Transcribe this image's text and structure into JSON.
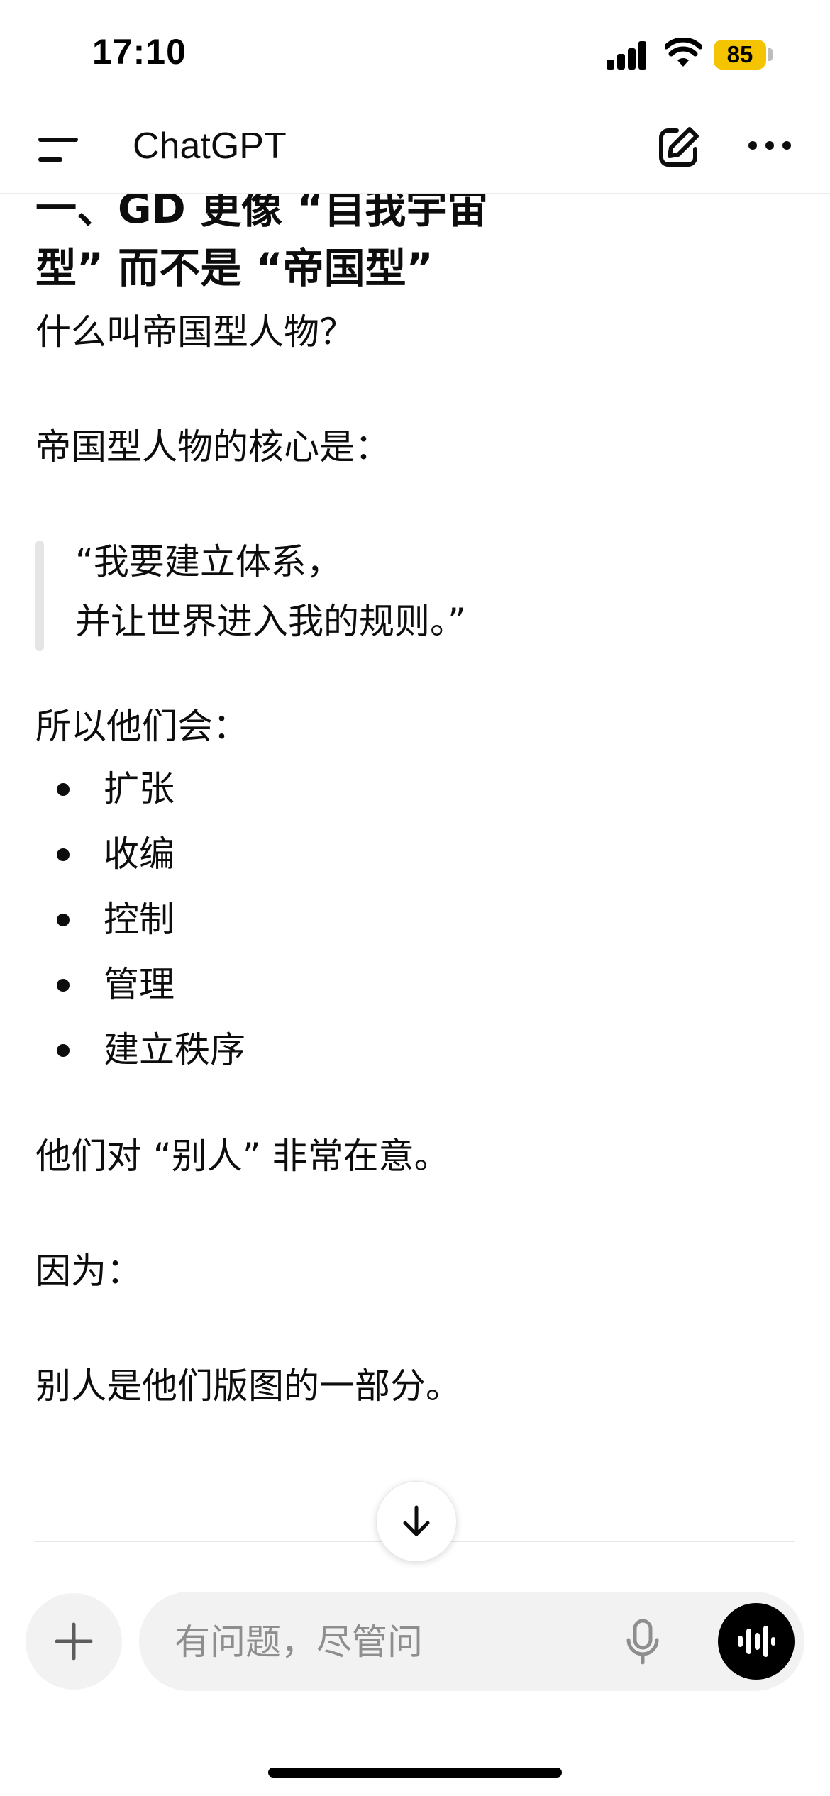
{
  "status_bar": {
    "time": "17:10",
    "battery_level": "85",
    "battery_color": "#f5c400"
  },
  "nav": {
    "title": "ChatGPT",
    "menu_icon": "menu-icon",
    "new_chat_icon": "edit-icon",
    "more_icon": "more-icon"
  },
  "message": {
    "heading_line1": "一、GD 更像 “自我宇宙",
    "heading_line2": "型” 而不是 “帝国型”",
    "p1": "什么叫帝国型人物？",
    "p2": "帝国型人物的核心是：",
    "quote_line1": "“我要建立体系，",
    "quote_line2": "并让世界进入我的规则。”",
    "p3": "所以他们会：",
    "bullets": [
      "扩张",
      "收编",
      "控制",
      "管理",
      "建立秩序"
    ],
    "p4": "他们对 “别人” 非常在意。",
    "p5": "因为：",
    "p6": "别人是他们版图的一部分。"
  },
  "composer": {
    "placeholder": "有问题，尽管问",
    "add_icon": "plus-icon",
    "mic_icon": "mic-icon",
    "voice_icon": "voice-mode-icon"
  },
  "scroll_icon": "arrow-down-icon"
}
